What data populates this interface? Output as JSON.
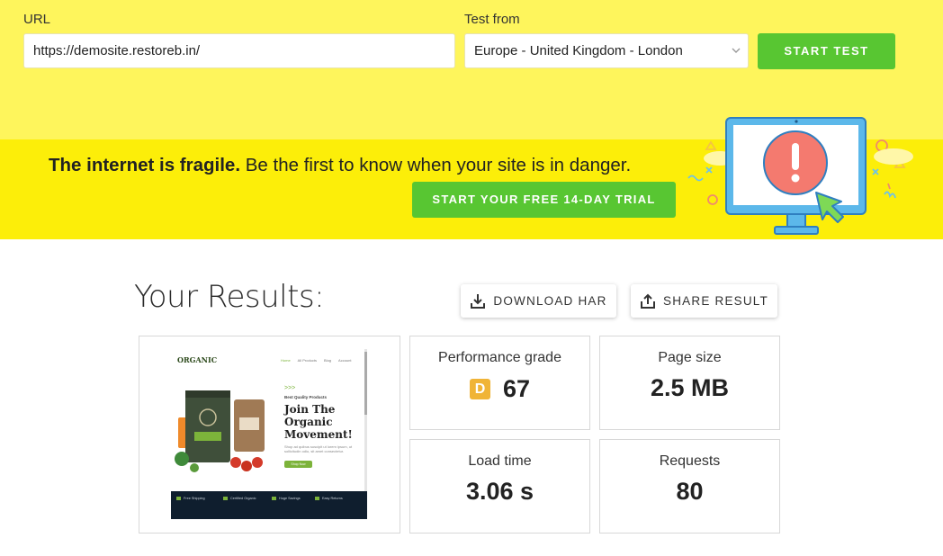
{
  "form": {
    "url_label": "URL",
    "url_value": "https://demosite.restoreb.in/",
    "test_from_label": "Test from",
    "test_from_value": "Europe - United Kingdom - London",
    "start_button": "START TEST"
  },
  "promo": {
    "headline_bold": "The internet is fragile.",
    "headline_rest": " Be the first to know when your site is in danger.",
    "trial_button": "START YOUR FREE 14-DAY TRIAL"
  },
  "results": {
    "title": "Your Results:",
    "download_button": "DOWNLOAD HAR",
    "share_button": "SHARE RESULT",
    "performance_grade_label": "Performance grade",
    "performance_grade_letter": "D",
    "performance_grade_score": "67",
    "page_size_label": "Page size",
    "page_size_value": "2.5 MB",
    "load_time_label": "Load time",
    "load_time_value": "3.06 s",
    "requests_label": "Requests",
    "requests_value": "80"
  },
  "screenshot": {
    "logo": "ORGANIC",
    "nav": [
      "Home",
      "All Products",
      "Blog",
      "Account"
    ],
    "kicker": "Best Quality Products",
    "hero": "Join The Organic Movement!",
    "blurb": "Shop ad quibus suscipit ut lorem ipsum, ut sollicitudin odio, sit amet consectetur.",
    "shop_button": "Shop Now",
    "features": [
      "Free Shipping",
      "Certified Organic",
      "Huge Savings",
      "Easy Returns"
    ]
  },
  "colors": {
    "form_bg": "#fef55c",
    "promo_bg": "#fcee09",
    "accent_green": "#58c632",
    "grade_badge": "#f0b437"
  }
}
